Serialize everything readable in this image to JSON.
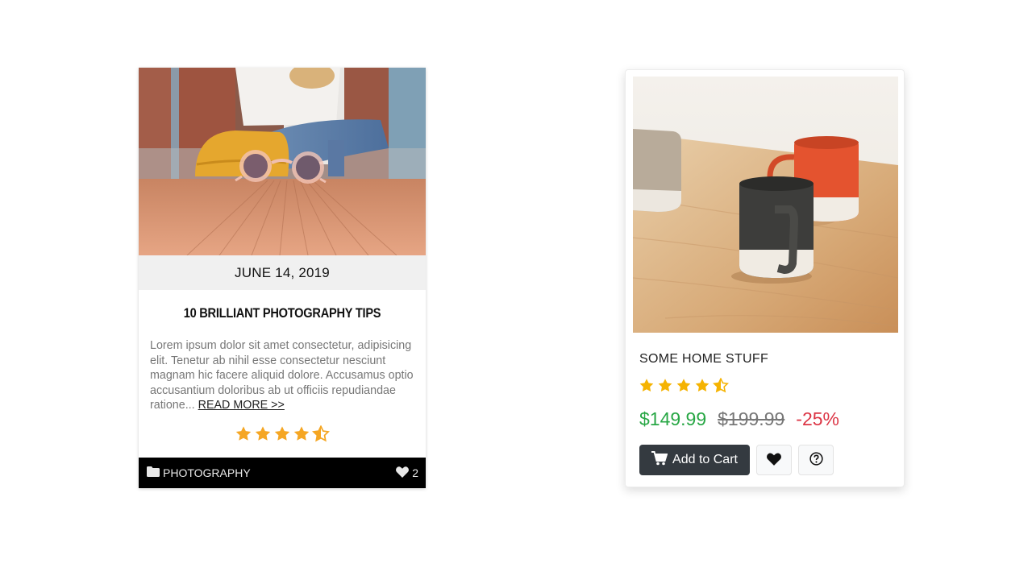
{
  "blog_card": {
    "date": "JUNE 14, 2019",
    "title": "10 BRILLIANT PHOTOGRAPHY TIPS",
    "excerpt": "Lorem ipsum dolor sit amet consectetur, adipisicing elit. Tenetur ab nihil esse consectetur nesciunt magnam hic facere aliquid dolore. Accusamus optio accusantium doloribus ab ut officiis repudiandae ratione...",
    "read_more": "READ MORE >>",
    "rating": 4.5,
    "category": "PHOTOGRAPHY",
    "likes": "2",
    "icons": {
      "category": "folder-icon",
      "likes": "heart-icon"
    },
    "colors": {
      "star": "#f5a623",
      "footer_bg": "#000000"
    }
  },
  "product_card": {
    "title": "SOME HOME STUFF",
    "rating": 4.5,
    "price": "$149.99",
    "old_price": "$199.99",
    "discount": "-25%",
    "add_to_cart_label": "Add to Cart",
    "icons": {
      "cart": "cart-icon",
      "wishlist": "heart-icon",
      "help": "question-circle-icon"
    },
    "colors": {
      "price": "#28a745",
      "discount": "#dc3545",
      "button": "#343a40",
      "star": "#f5b301"
    }
  }
}
